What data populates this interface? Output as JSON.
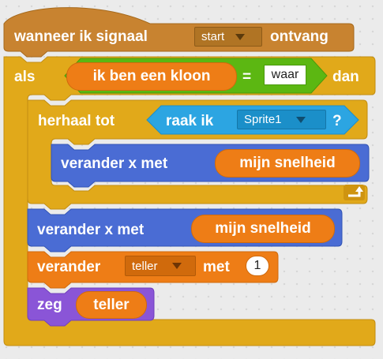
{
  "hat": {
    "prefix": "wanneer ik signaal",
    "message": "start",
    "suffix": "ontvang"
  },
  "if_block": {
    "keyword": "als",
    "then": "dan"
  },
  "clone_reporter": {
    "label": "ik ben een kloon"
  },
  "equals": {
    "operator": "=",
    "value": "waar"
  },
  "repeat_until": {
    "keyword": "herhaal tot"
  },
  "touching": {
    "prefix": "raak ik",
    "target": "Sprite1",
    "suffix": "?"
  },
  "inner_change": {
    "prefix": "verander x met",
    "variable": "mijn snelheid"
  },
  "change_x": {
    "prefix": "verander x met",
    "variable": "mijn snelheid"
  },
  "change_var": {
    "prefix": "verander",
    "variable": "teller",
    "middle": "met",
    "value": "1"
  },
  "say": {
    "prefix": "zeg",
    "variable": "teller"
  },
  "colors": {
    "events": "#c88330",
    "control": "#e1a91a",
    "operators": "#5cb712",
    "sensing": "#2ca5e2",
    "motion": "#4a6cd4",
    "variables": "#ee7d16",
    "looks": "#8a55d7"
  }
}
